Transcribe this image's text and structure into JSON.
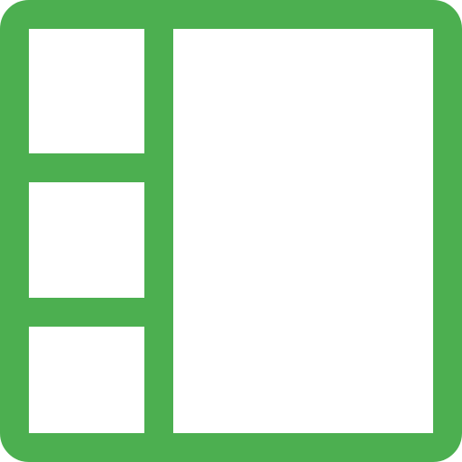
{
  "icon": {
    "name": "sidebar-layout-icon",
    "stroke_color": "#4caf50",
    "fill_color": "#ffffff"
  }
}
